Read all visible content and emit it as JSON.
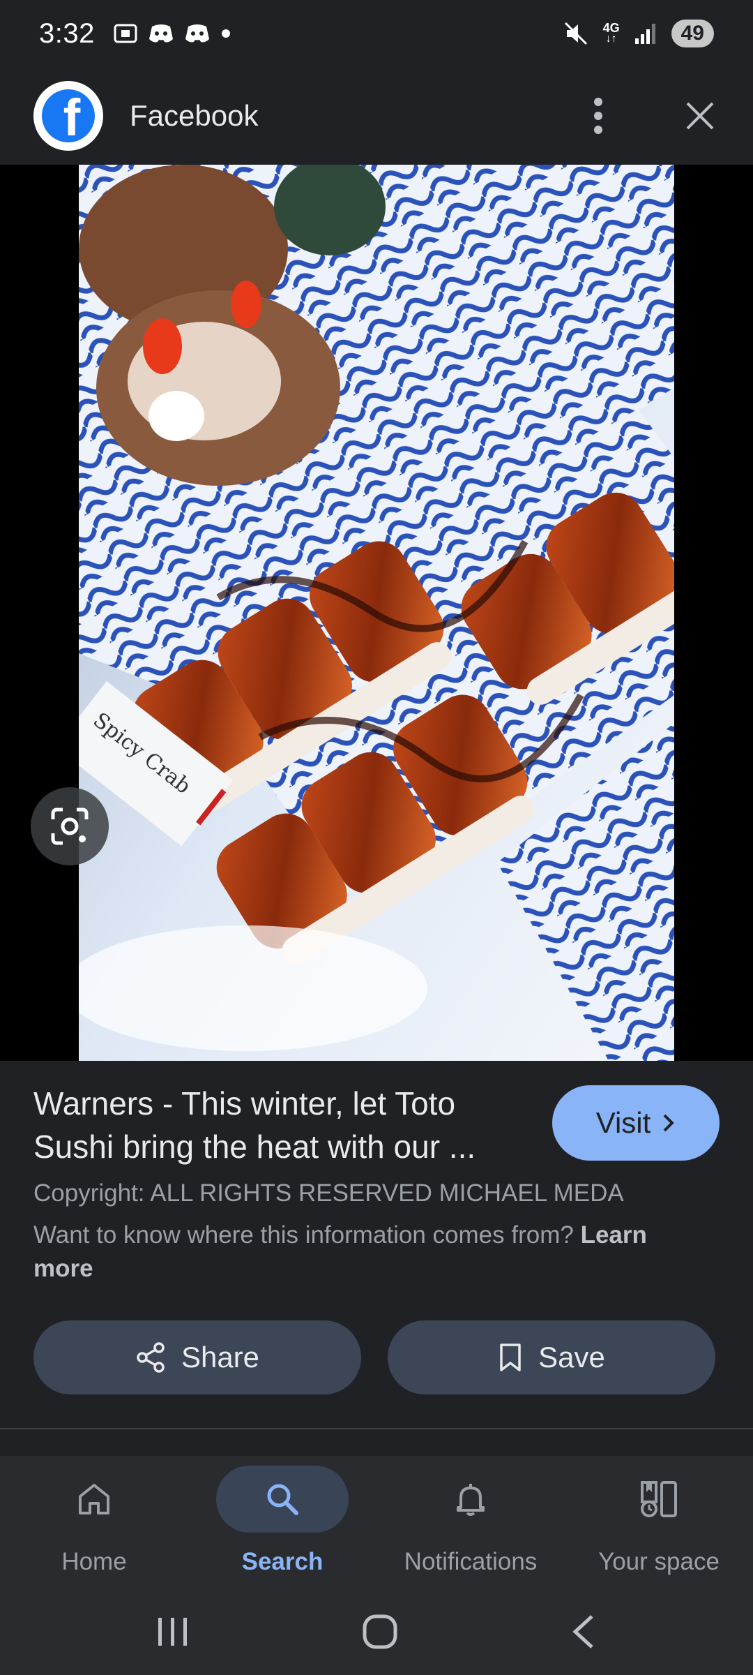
{
  "status_bar": {
    "time": "3:32",
    "network_label": "4G",
    "battery": "49"
  },
  "header": {
    "source_name": "Facebook",
    "logo_letter": "f"
  },
  "image": {
    "sign_text": "Spicy Crab"
  },
  "info": {
    "title": "Warners - This winter, let Toto Sushi bring the heat with our ...",
    "visit_label": "Visit",
    "copyright": "Copyright: ALL RIGHTS RESERVED MICHAEL MEDA",
    "provenance_text": "Want to know where this information comes from?",
    "learn_more": "Learn more"
  },
  "actions": {
    "share_label": "Share",
    "save_label": "Save"
  },
  "bottom_nav": {
    "items": [
      {
        "label": "Home",
        "icon": "home-icon",
        "active": false
      },
      {
        "label": "Search",
        "icon": "search-icon",
        "active": true
      },
      {
        "label": "Notifications",
        "icon": "bell-icon",
        "active": false
      },
      {
        "label": "Your space",
        "icon": "your-space-icon",
        "active": false
      }
    ]
  },
  "colors": {
    "background": "#202124",
    "accent": "#8ab4f8",
    "button": "#3c4656",
    "facebook_blue": "#1877f2"
  }
}
